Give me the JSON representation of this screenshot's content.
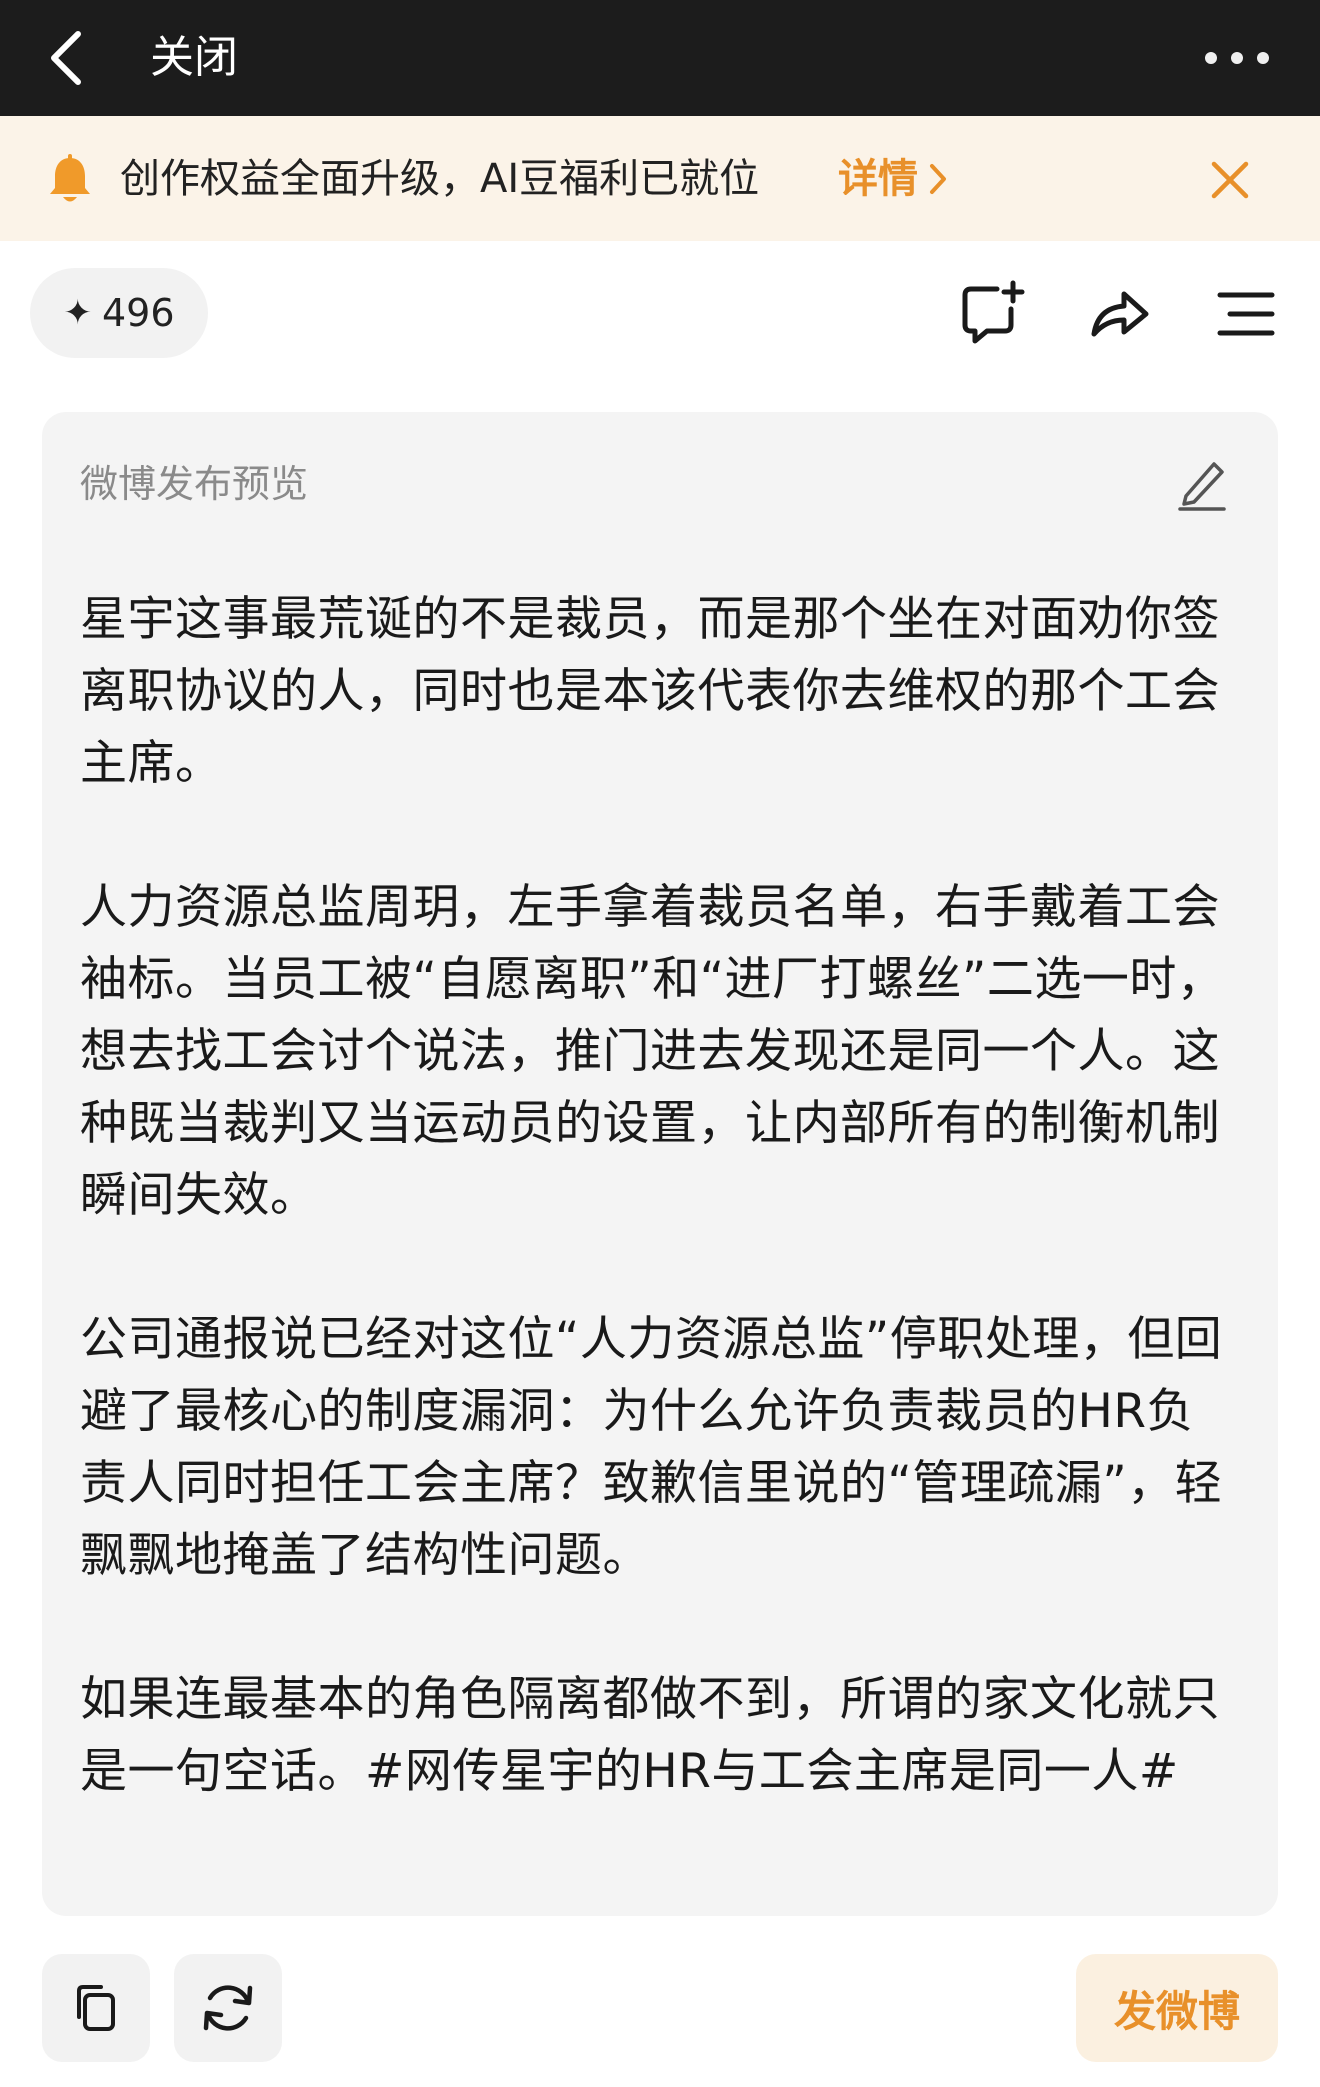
{
  "topbar": {
    "close_label": "关闭"
  },
  "notice": {
    "text": "创作权益全面升级，AI豆福利已就位",
    "link_label": "详情"
  },
  "stats": {
    "count": "496"
  },
  "card": {
    "label": "微博发布预览",
    "paragraphs": [
      "星宇这事最荒诞的不是裁员，而是那个坐在对面劝你签离职协议的人，同时也是本该代表你去维权的那个工会主席。",
      "人力资源总监周玥，左手拿着裁员名单，右手戴着工会袖标。当员工被“自愿离职”和“进厂打螺丝”二选一时，想去找工会讨个说法，推门进去发现还是同一个人。这种既当裁判又当运动员的设置，让内部所有的制衡机制瞬间失效。",
      "公司通报说已经对这位“人力资源总监”停职处理，但回避了最核心的制度漏洞：为什么允许负责裁员的HR负责人同时担任工会主席？致歉信里说的“管理疏漏”，轻飘飘地掩盖了结构性问题。",
      "如果连最基本的角色隔离都做不到，所谓的家文化就只是一句空话。#网传星宇的HR与工会主席是同一人#"
    ]
  },
  "footer": {
    "post_label": "发微博"
  },
  "colors": {
    "accent": "#e8902a",
    "topbar_bg": "#1c1c1c",
    "notice_bg": "#fbf3e8",
    "card_bg": "#f4f4f4"
  }
}
